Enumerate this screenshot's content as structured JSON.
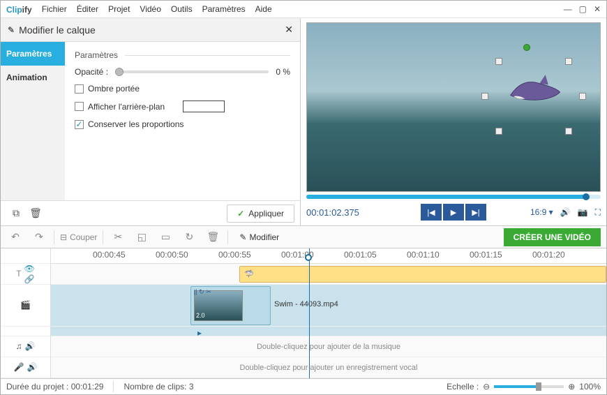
{
  "app": {
    "name_c": "Clip",
    "name_rest": "ify"
  },
  "menu": [
    "Fichier",
    "Éditer",
    "Projet",
    "Vidéo",
    "Outils",
    "Paramètres",
    "Aide"
  ],
  "panel": {
    "title": "Modifier le calque",
    "tabs": {
      "params": "Paramètres",
      "anim": "Animation"
    },
    "section": "Paramètres",
    "opacity_label": "Opacité :",
    "opacity_value": "0 %",
    "shadow": "Ombre portée",
    "showbg": "Afficher l'arrière-plan",
    "aspect": "Conserver les proportions",
    "apply": "Appliquer"
  },
  "preview": {
    "time": "00:01:02.375",
    "ratio": "16:9"
  },
  "toolbar": {
    "cut": "Couper",
    "modify": "Modifier",
    "create": "CRÉER UNE VIDÉO"
  },
  "ruler": [
    "00:00:45",
    "00:00:50",
    "00:00:55",
    "00:01:00",
    "00:01:05",
    "00:01:10",
    "00:01:15",
    "00:01:20"
  ],
  "tracks": {
    "videoClip": "Swim - 44093.mp4",
    "clipDur": "2.0",
    "music_hint": "Double-cliquez pour ajouter de la musique",
    "voice_hint": "Double-cliquez pour ajouter un enregistrement vocal"
  },
  "status": {
    "dur_label": "Durée du projet :",
    "dur": "00:01:29",
    "clips_label": "Nombre de clips:",
    "clips": "3",
    "scale_label": "Echelle :",
    "scale_val": "100%"
  }
}
